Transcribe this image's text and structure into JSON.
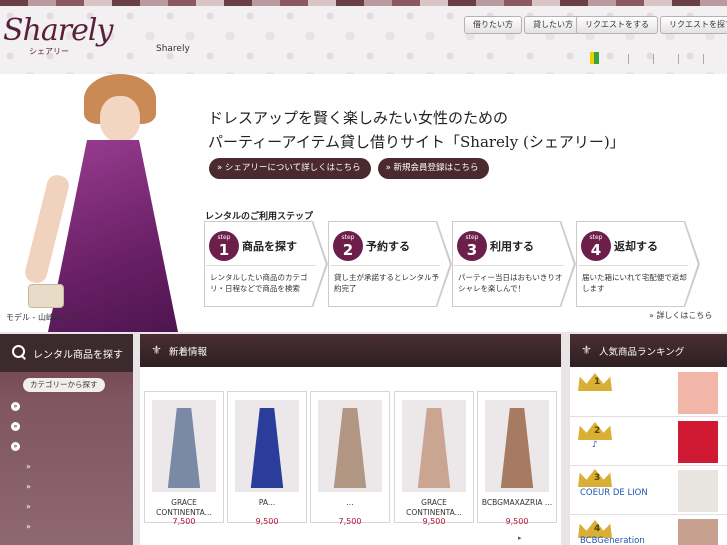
{
  "header": {
    "logo_text": "Sharely",
    "logo_sub": "シェアリー",
    "site_label": "Sharely",
    "buttons_left": [
      "借りたい方",
      "貸したい方"
    ],
    "buttons_right": [
      "リクエストをする",
      "リクエストを探す"
    ]
  },
  "hero": {
    "title_line1": "ドレスアップを賢く楽しみたい女性のための",
    "title_line2": "パーティーアイテム貸し借りサイト「Sharely (シェアリー)」",
    "about_button": "» シェアリーについて詳しくはこちら",
    "register_button": "» 新規会員登録はこちら",
    "model_caption": "モデル - 山崎みどり"
  },
  "steps": {
    "heading": "レンタルのご利用ステップ",
    "step_label": "step",
    "items": [
      {
        "num": "1",
        "title": "商品を探す",
        "desc": "レンタルしたい商品のカテゴリ・日程などで商品を検索"
      },
      {
        "num": "2",
        "title": "予約する",
        "desc": "貸し主が承諾するとレンタル予約完了"
      },
      {
        "num": "3",
        "title": "利用する",
        "desc": "パーティー当日はおもいきりオシャレを楽しんで！"
      },
      {
        "num": "4",
        "title": "返却する",
        "desc": "届いた箱にいれて宅配便で返却します"
      }
    ],
    "details_link": "» 詳しくはこちら"
  },
  "sidebar": {
    "title": "レンタル商品を探す",
    "category_button": "カテゴリーから探す",
    "category_icon": "»",
    "sub_arrow": "»"
  },
  "new_arrivals": {
    "title": "新着情報",
    "products": [
      {
        "name": "GRACE CONTINENTA...",
        "price": "7,500",
        "color": "#7a8aa6"
      },
      {
        "name": "PA...",
        "price": "9,500",
        "color": "#2a3d9a"
      },
      {
        "name": "...",
        "price": "7,500",
        "color": "#b29684"
      },
      {
        "name": "GRACE CONTINENTA...",
        "price": "9,500",
        "color": "#caa592"
      },
      {
        "name": "BCBGMAXAZRIA ...",
        "price": "9,500",
        "color": "#a77a62"
      }
    ],
    "more_arrow": "▸"
  },
  "ranking": {
    "title": "人気商品ランキング",
    "items": [
      {
        "rank": "1",
        "brand": "",
        "thumb_color": "#f2b6a8"
      },
      {
        "rank": "2",
        "brand": "♪",
        "thumb_color": "#d01a34"
      },
      {
        "rank": "3",
        "brand": "COEUR DE LION",
        "thumb_color": "#e8e4e0"
      },
      {
        "rank": "4",
        "brand": "BCBGeneration",
        "thumb_color": "#c8a090"
      }
    ]
  }
}
